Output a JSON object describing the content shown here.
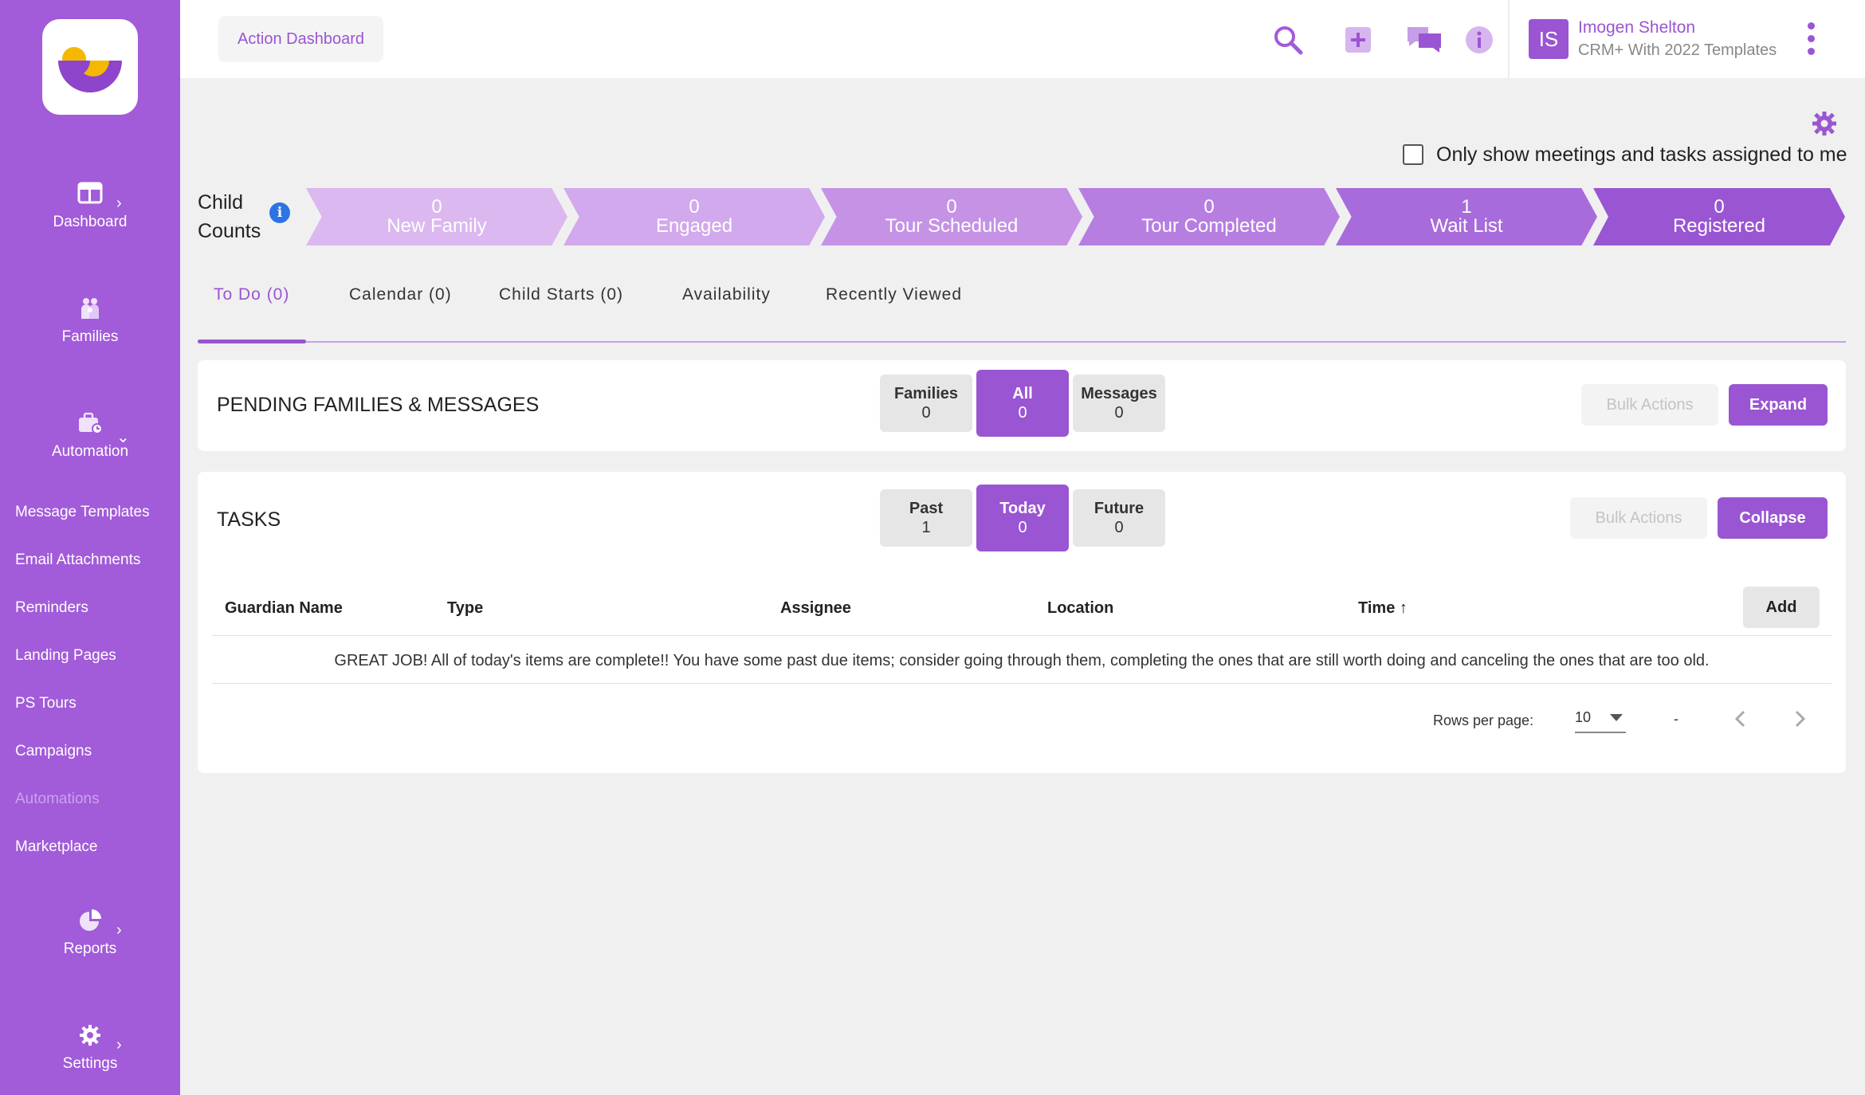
{
  "sidebar": {
    "main_items": [
      {
        "label": "Dashboard",
        "icon": "dashboard-icon"
      },
      {
        "label": "Families",
        "icon": "families-icon"
      },
      {
        "label": "Automation",
        "icon": "automation-icon"
      },
      {
        "label": "Reports",
        "icon": "reports-icon"
      },
      {
        "label": "Settings",
        "icon": "settings-icon"
      }
    ],
    "sub_items": [
      {
        "label": "Message Templates"
      },
      {
        "label": "Email Attachments"
      },
      {
        "label": "Reminders"
      },
      {
        "label": "Landing Pages"
      },
      {
        "label": "PS Tours"
      },
      {
        "label": "Campaigns"
      },
      {
        "label": "Automations",
        "active": true
      },
      {
        "label": "Marketplace"
      }
    ]
  },
  "header": {
    "breadcrumb": "Action Dashboard",
    "icons": [
      "search-icon",
      "add-icon",
      "chat-icon",
      "info-icon"
    ],
    "user": {
      "initials": "IS",
      "name": "Imogen Shelton",
      "org": "CRM+ With 2022 Templates"
    }
  },
  "filters": {
    "only_mine_label": "Only show meetings and tasks assigned to me",
    "only_mine_checked": false
  },
  "child_counts": {
    "title_line1": "Child",
    "title_line2": "Counts",
    "stages": [
      {
        "count": "0",
        "label": "New Family",
        "color": "#dbb8ef"
      },
      {
        "count": "0",
        "label": "Engaged",
        "color": "#d1a9ec"
      },
      {
        "count": "0",
        "label": "Tour Scheduled",
        "color": "#c592e6"
      },
      {
        "count": "0",
        "label": "Tour Completed",
        "color": "#b77ee1"
      },
      {
        "count": "1",
        "label": "Wait List",
        "color": "#a86bdb"
      },
      {
        "count": "0",
        "label": "Registered",
        "color": "#9a55d2"
      }
    ]
  },
  "tabs": [
    {
      "label": "To Do (0)",
      "active": true
    },
    {
      "label": "Calendar (0)"
    },
    {
      "label": "Child Starts (0)"
    },
    {
      "label": "Availability"
    },
    {
      "label": "Recently Viewed"
    }
  ],
  "pending": {
    "title": "PENDING FAMILIES & MESSAGES",
    "segments": [
      {
        "label": "Families",
        "count": "0"
      },
      {
        "label": "All",
        "count": "0",
        "active": true
      },
      {
        "label": "Messages",
        "count": "0"
      }
    ],
    "bulk_label": "Bulk Actions",
    "expand_label": "Expand"
  },
  "tasks": {
    "title": "TASKS",
    "segments": [
      {
        "label": "Past",
        "count": "1"
      },
      {
        "label": "Today",
        "count": "0",
        "active": true
      },
      {
        "label": "Future",
        "count": "0"
      }
    ],
    "bulk_label": "Bulk Actions",
    "collapse_label": "Collapse",
    "columns": [
      "Guardian Name",
      "Type",
      "Assignee",
      "Location",
      "Time"
    ],
    "sort_indicator": "↑",
    "add_label": "Add",
    "empty_message": "GREAT JOB! All of today's items are complete!! You have some past due items; consider going through them, completing the ones that are still worth doing and canceling the ones that are too old.",
    "pager": {
      "rows_label": "Rows per page:",
      "rows_value": "10",
      "range": "-"
    }
  },
  "colors": {
    "brand": "#9a55d2",
    "sidebar": "#a25bd9",
    "background": "#f0f0f0",
    "info_blue": "#2d74e3"
  }
}
